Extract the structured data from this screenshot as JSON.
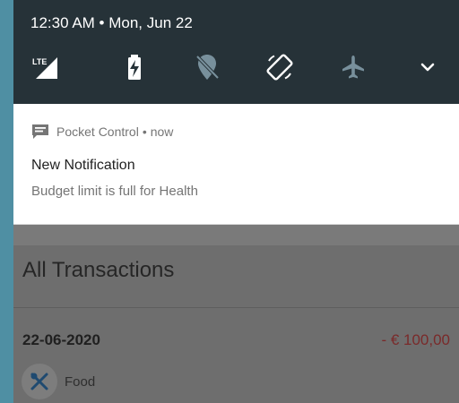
{
  "status": {
    "datetime": "12:30 AM • Mon, Jun 22"
  },
  "quick_settings": {
    "icons": [
      "lte-signal-icon",
      "battery-charging-icon",
      "location-off-icon",
      "auto-rotate-icon",
      "airplane-mode-icon",
      "expand-chevron-icon"
    ],
    "network_label": "LTE"
  },
  "notification": {
    "app_name": "Pocket Control",
    "separator": "•",
    "time": "now",
    "title": "New Notification",
    "body": "Budget limit is full for Health"
  },
  "app": {
    "heading": "All Transactions",
    "transactions": [
      {
        "date": "22-06-2020",
        "amount": "- € 100,00",
        "category": "Food",
        "icon": "fork-knife-icon"
      }
    ]
  },
  "colors": {
    "qs_background": "#263238",
    "notification_background": "#ffffff",
    "scrim": "#6e6e6e",
    "expense_red": "#7a2a2a",
    "frame": "#4f8fa3"
  }
}
